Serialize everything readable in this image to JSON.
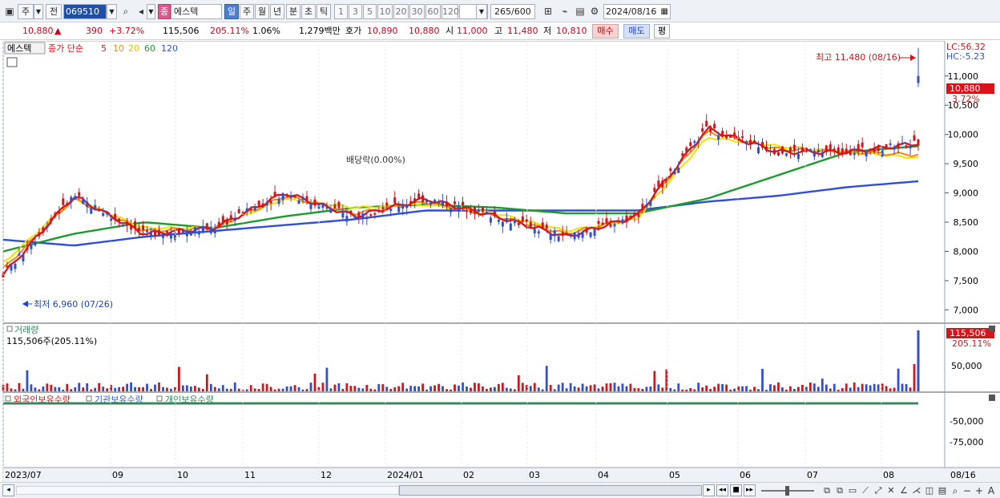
{
  "toolbar": {
    "period_label": "주",
    "prev_label": "전",
    "stock_code": "069510",
    "indicator_label": "종",
    "stock_name": "에스텍",
    "period_tabs": [
      "일",
      "주",
      "월",
      "년",
      "분",
      "초",
      "틱"
    ],
    "active_tab": "일",
    "intervals": [
      "1",
      "3",
      "5",
      "10",
      "20",
      "30",
      "60",
      "120"
    ],
    "count_value": "265",
    "count_total": "/600",
    "date_value": "2024/08/16"
  },
  "quote": {
    "price": "10,880",
    "change_arrow": "▲",
    "change": "390",
    "change_pct": "+3.72%",
    "volume": "115,506",
    "volume_ratio": "205.11%",
    "turnover": "1.06%",
    "amount": "1,279백만",
    "bid_label": "호가",
    "bid_1": "10,890",
    "bid_2": "10,880",
    "open_label": "시",
    "open": "11,000",
    "high_label": "고",
    "high": "11,480",
    "low_label": "저",
    "low": "10,810",
    "buy_label": "매수",
    "sell_label": "매도",
    "eval_label": "평"
  },
  "price_panel": {
    "name_tag": "에스텍",
    "legend_prefix": "종가 단순",
    "ma_periods": [
      "5",
      "10",
      "20",
      "60",
      "120"
    ],
    "lc_label": "LC:56.32",
    "hc_label": "HC:-5.23",
    "max_label": "최고 11,480 (08/16)",
    "min_label": "최저 6,960 (07/26)",
    "dividend_label": "배당락(0.00%)",
    "price_tag": "10,880",
    "pct_tag": "3.72%",
    "y_ticks": [
      "11,000",
      "10,500",
      "10,000",
      "9,500",
      "9,000",
      "8,500",
      "8,000",
      "7,500",
      "7,000"
    ]
  },
  "volume_panel": {
    "title": "거래량",
    "detail": "115,506주(205.11%)",
    "tag_value": "115,506",
    "tag_pct": "205.11%",
    "y_ticks": [
      "50,000"
    ]
  },
  "holdings_panel": {
    "legend": [
      "외국인보유수량",
      "기관보유수량",
      "개인보유수량"
    ],
    "y_ticks": [
      "-50,000",
      "-75,000"
    ]
  },
  "x_axis": {
    "labels": [
      "2023/07",
      "09",
      "10",
      "11",
      "12",
      "2024/01",
      "02",
      "03",
      "04",
      "05",
      "06",
      "07",
      "08"
    ],
    "end_label": "08/16"
  },
  "colors": {
    "ma5": "#d8141b",
    "ma10": "#f08a14",
    "ma20": "#f2e200",
    "ma60": "#1e9a2e",
    "ma120": "#2f4fd8",
    "up": "#d8141b",
    "down": "#2f4fd8",
    "foreign": "#d8141b",
    "institution": "#2f5fd8",
    "individual": "#2e8b57"
  },
  "chart_data": {
    "type": "line",
    "title": "에스텍",
    "x": [
      "2023/07",
      "09",
      "10",
      "11",
      "12",
      "2024/01",
      "02",
      "03",
      "04",
      "05",
      "06",
      "07",
      "08",
      "08/16"
    ],
    "series": [
      {
        "name": "5",
        "values": [
          7600,
          8950,
          8300,
          8400,
          9000,
          8600,
          8900,
          8600,
          8250,
          8600,
          10100,
          9700,
          9700,
          9850
        ]
      },
      {
        "name": "10",
        "values": [
          7700,
          8900,
          8350,
          8400,
          8950,
          8650,
          8850,
          8600,
          8300,
          8600,
          10050,
          9750,
          9700,
          9650
        ]
      },
      {
        "name": "20",
        "values": [
          7800,
          8900,
          8400,
          8400,
          8900,
          8750,
          8800,
          8650,
          8350,
          8550,
          9950,
          9800,
          9700,
          9600
        ]
      },
      {
        "name": "60",
        "values": [
          8000,
          8300,
          8500,
          8400,
          8600,
          8750,
          8800,
          8750,
          8650,
          8650,
          8900,
          9300,
          9700,
          9800
        ]
      },
      {
        "name": "120",
        "values": [
          8200,
          8100,
          8250,
          8350,
          8450,
          8550,
          8700,
          8700,
          8700,
          8700,
          8850,
          8950,
          9100,
          9200
        ]
      }
    ],
    "ylim": [
      6800,
      11600
    ],
    "max_point": {
      "value": 11480,
      "date": "08/16"
    },
    "min_point": {
      "value": 6960,
      "date": "07/26"
    },
    "last": 10880
  }
}
